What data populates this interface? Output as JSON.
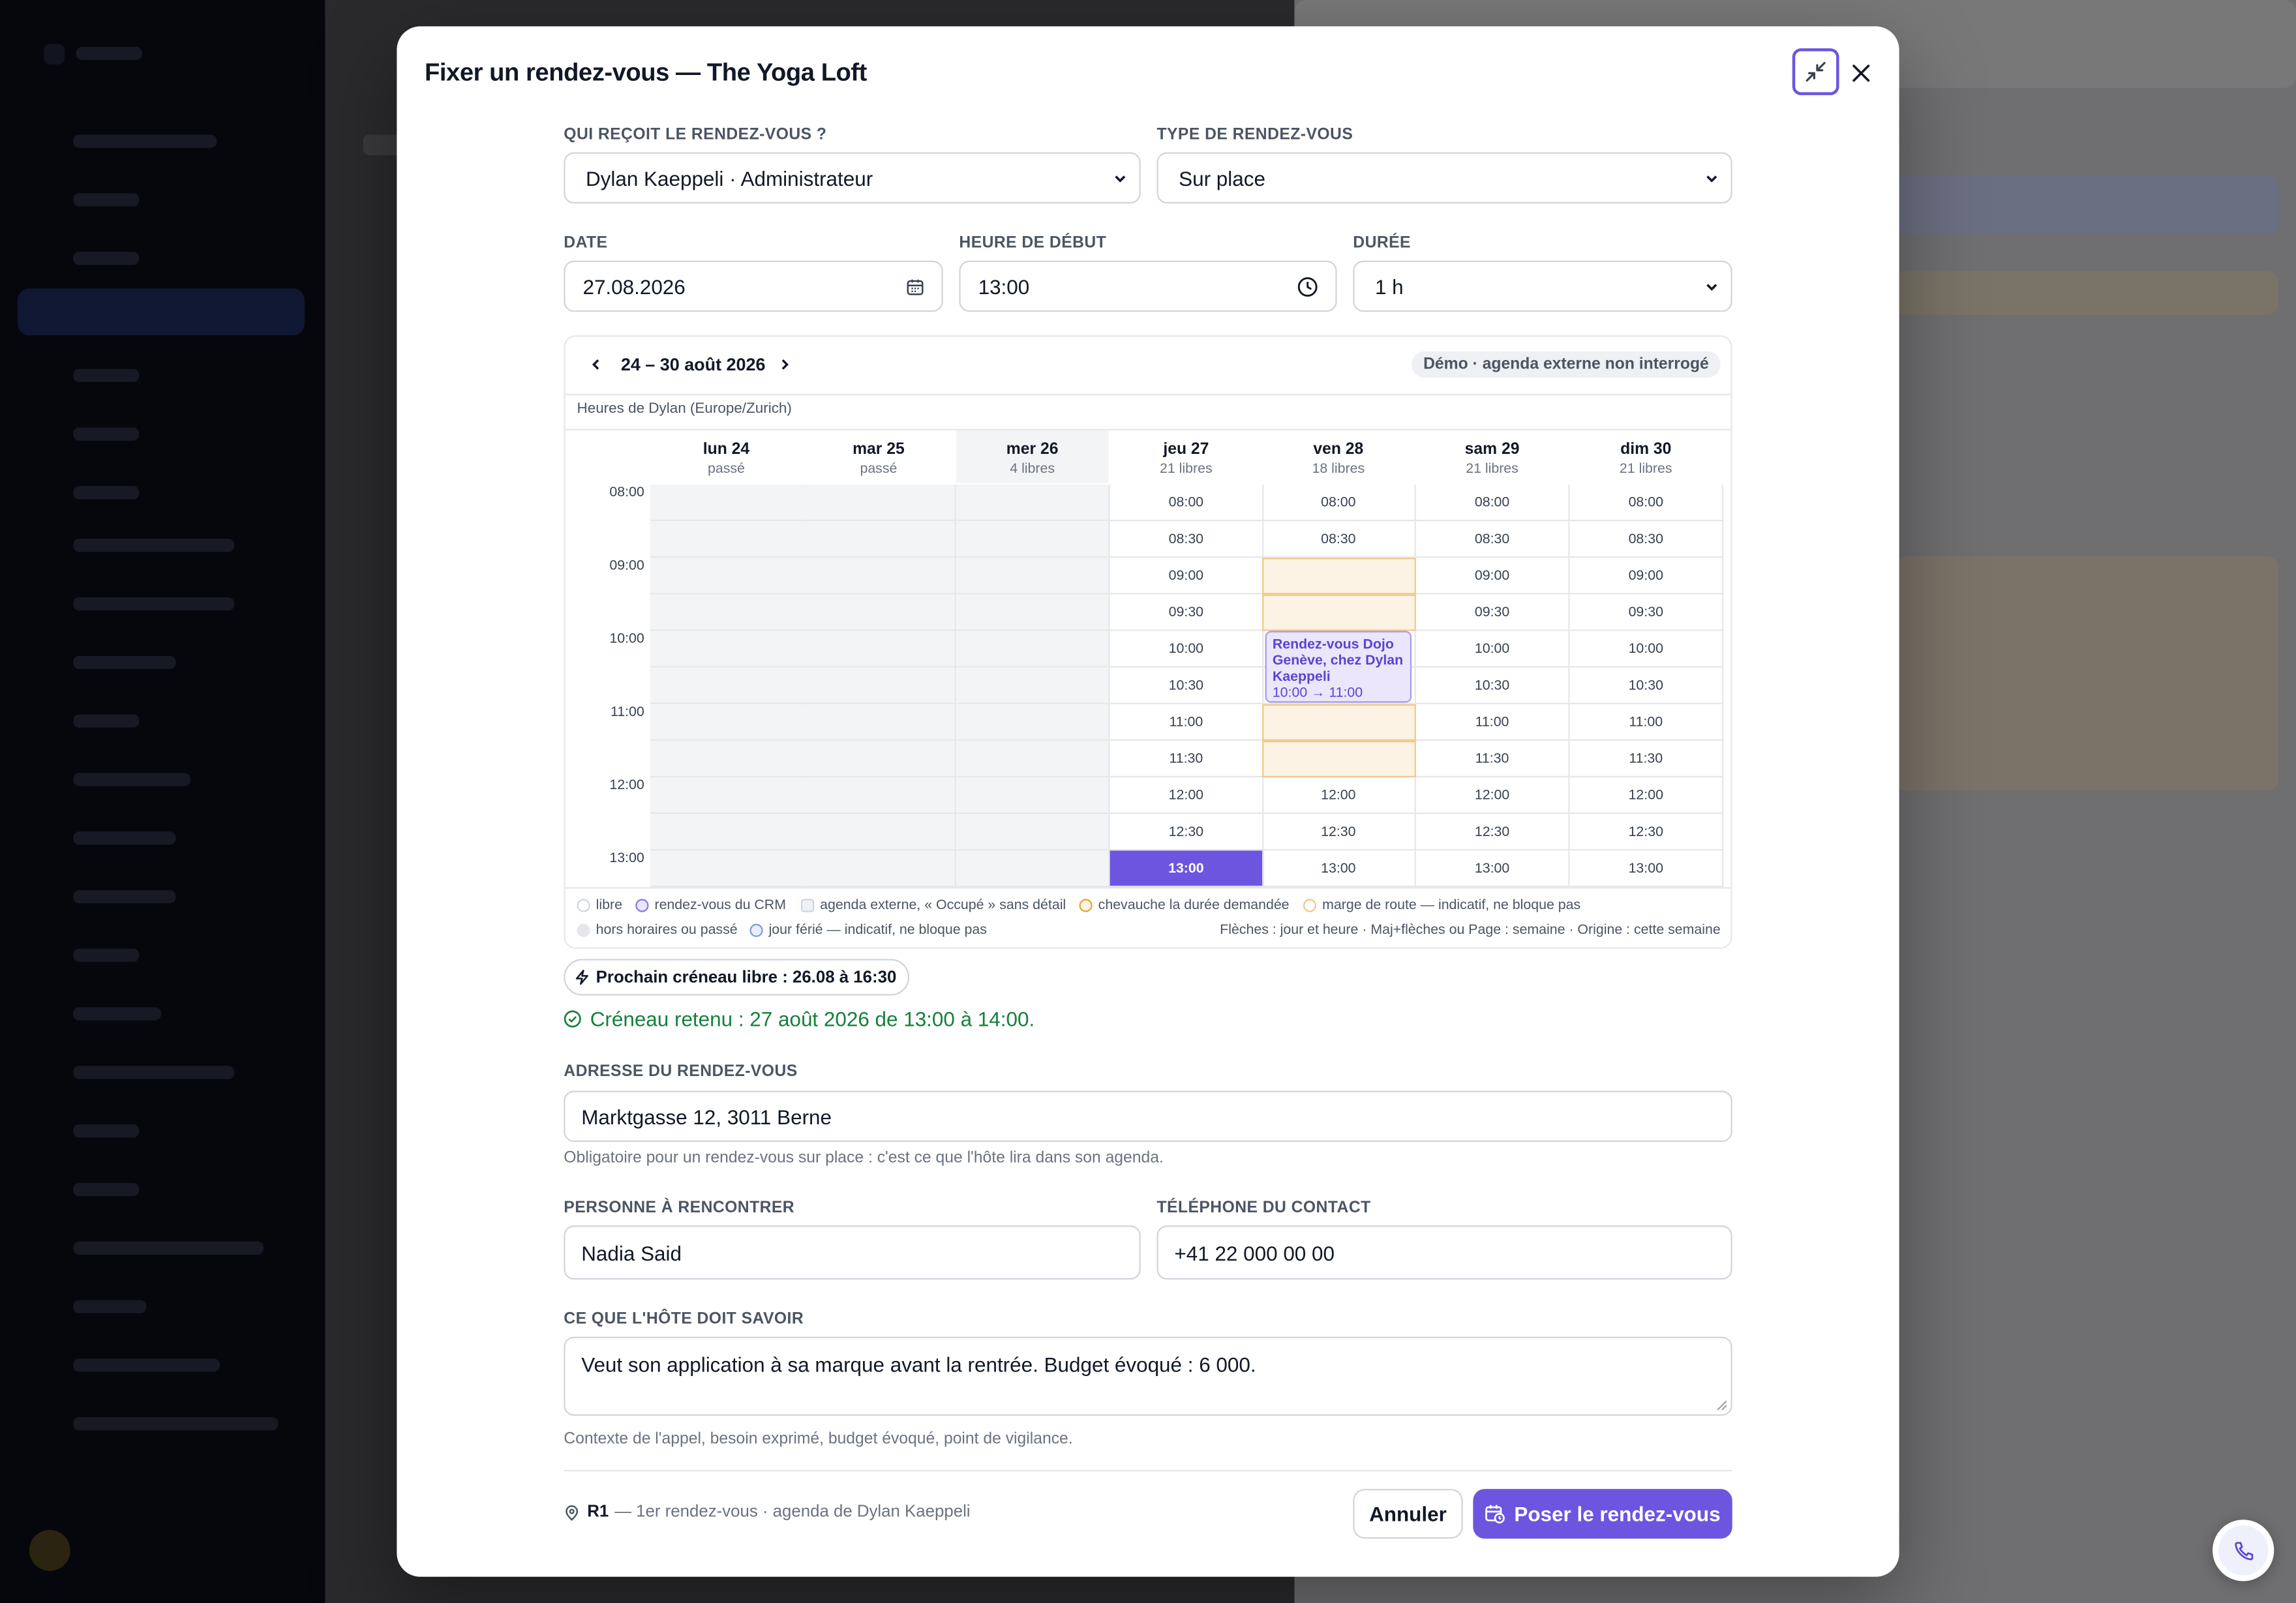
{
  "modal": {
    "title": "Fixer un rendez-vous — The Yoga Loft"
  },
  "form": {
    "recipient": {
      "label": "QUI REÇOIT LE RENDEZ-VOUS ?",
      "value": "Dylan Kaeppeli · Administrateur"
    },
    "type": {
      "label": "TYPE DE RENDEZ-VOUS",
      "value": "Sur place"
    },
    "date": {
      "label": "DATE",
      "value": "27.08.2026"
    },
    "start": {
      "label": "HEURE DE DÉBUT",
      "value": "13:00"
    },
    "duration": {
      "label": "DURÉE",
      "value": "1 h"
    },
    "address": {
      "label": "ADRESSE DU RENDEZ-VOUS",
      "value": "Marktgasse 12, 3011 Berne",
      "help": "Obligatoire pour un rendez-vous sur place : c'est ce que l'hôte lira dans son agenda."
    },
    "person": {
      "label": "PERSONNE À RENCONTRER",
      "value": "Nadia Said"
    },
    "phone": {
      "label": "TÉLÉPHONE DU CONTACT",
      "value": "+41 22 000 00 00"
    },
    "notes": {
      "label": "CE QUE L'HÔTE DOIT SAVOIR",
      "value": "Veut son application à sa marque avant la rentrée. Budget évoqué : 6 000.",
      "help": "Contexte de l'appel, besoin exprimé, budget évoqué, point de vigilance."
    }
  },
  "calendar": {
    "week_range": "24 – 30 août 2026",
    "demo_badge": "Démo · agenda externe non interrogé",
    "timezone": "Heures de Dylan (Europe/Zurich)",
    "hours": [
      "08:00",
      "09:00",
      "10:00",
      "11:00",
      "12:00",
      "13:00"
    ],
    "slot_times": [
      "08:00",
      "08:30",
      "09:00",
      "09:30",
      "10:00",
      "10:30",
      "11:00",
      "11:30",
      "12:00",
      "12:30",
      "13:00"
    ],
    "days": [
      {
        "name": "lun 24",
        "sub": "passé",
        "state": "past"
      },
      {
        "name": "mar 25",
        "sub": "passé",
        "state": "past"
      },
      {
        "name": "mer 26",
        "sub": "4 libres",
        "state": "past"
      },
      {
        "name": "jeu 27",
        "sub": "21 libres",
        "state": "open",
        "selected": "13:00"
      },
      {
        "name": "ven 28",
        "sub": "18 libres",
        "state": "open",
        "overlap": [
          "09:00",
          "09:30",
          "11:00",
          "11:30"
        ],
        "event_slots": [
          "10:00",
          "10:30"
        ]
      },
      {
        "name": "sam 29",
        "sub": "21 libres",
        "state": "open"
      },
      {
        "name": "dim 30",
        "sub": "21 libres",
        "state": "open"
      }
    ],
    "event": {
      "title": "Rendez-vous Dojo Genève, chez Dylan Kaeppeli",
      "time": "10:00 → 11:00"
    },
    "legend": {
      "free": "libre",
      "crm": "rendez-vous du CRM",
      "external": "agenda externe, « Occupé » sans détail",
      "overlap": "chevauche la durée demandée",
      "travel": "marge de route — indicatif, ne bloque pas",
      "off": "hors horaires ou passé",
      "holiday": "jour férié — indicatif, ne bloque pas",
      "shortcuts": "Flèches : jour et heure · Maj+flèches ou Page : semaine · Origine : cette semaine"
    }
  },
  "next_slot": "Prochain créneau libre : 26.08 à 16:30",
  "kept_slot": "Créneau retenu : 27 août 2026 de 13:00 à 14:00.",
  "footer": {
    "code": "R1",
    "info": "— 1er rendez-vous · agenda de Dylan Kaeppeli",
    "cancel": "Annuler",
    "submit": "Poser le rendez-vous"
  },
  "colors": {
    "accent": "#6d55e0",
    "success": "#15803d",
    "overlap_bg": "#fdf3e5"
  }
}
